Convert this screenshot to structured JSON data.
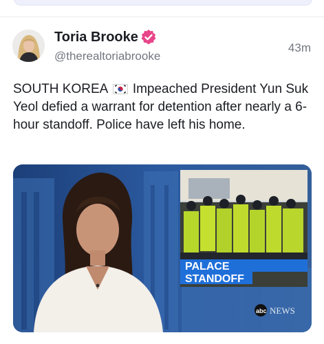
{
  "author": {
    "display_name": "Toria Brooke",
    "handle": "@therealtoriabrooke",
    "verified_icon": "verified-badge-icon",
    "badge_color": "#e8458a"
  },
  "post": {
    "time_ago": "43m",
    "text_before_flag": "SOUTH KOREA",
    "flag_icon": "south-korea-flag-icon",
    "text_after_flag": "Impeached President Yun Suk Yeol defied a warrant for detention after nearly a 6-hour standoff. Police have left his home."
  },
  "media": {
    "banner_line1": "PALACE",
    "banner_line2": "STANDOFF",
    "network_logo_text": "abc",
    "network_logo_suffix": "NEWS",
    "banner_color": "#1f6fd9"
  }
}
